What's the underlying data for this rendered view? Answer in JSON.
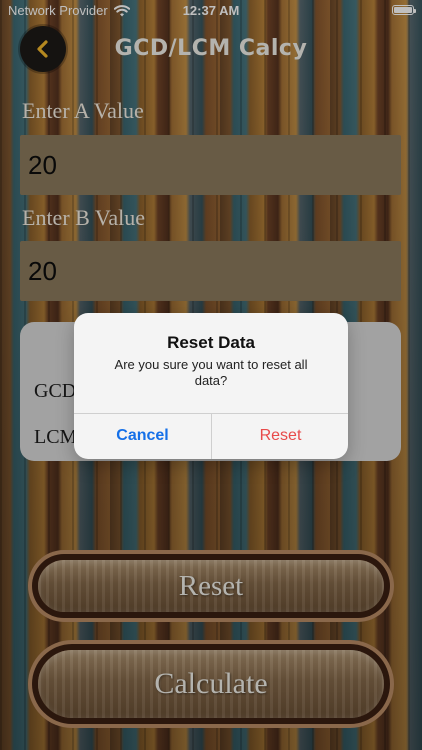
{
  "status_bar": {
    "carrier": "Network Provider",
    "time": "12:37 AM",
    "wifi_icon": "wifi-icon",
    "battery_icon": "battery-icon"
  },
  "header": {
    "back_icon": "chevron-left-icon",
    "title": "GCD/LCM Calcy"
  },
  "form": {
    "a_label": "Enter A Value",
    "a_value": "20",
    "b_label": "Enter B Value",
    "b_value": "20"
  },
  "results": {
    "gcd_label": "GCD",
    "lcm_label": "LCM"
  },
  "alert": {
    "title": "Reset Data",
    "message": "Are you sure you want to reset all data?",
    "cancel_label": "Cancel",
    "reset_label": "Reset"
  },
  "buttons": {
    "reset_label": "Reset",
    "calculate_label": "Calculate"
  },
  "colors": {
    "alert_cancel": "#1570e8",
    "alert_reset": "#e84a4a",
    "accent_back": "#f2b72b"
  }
}
